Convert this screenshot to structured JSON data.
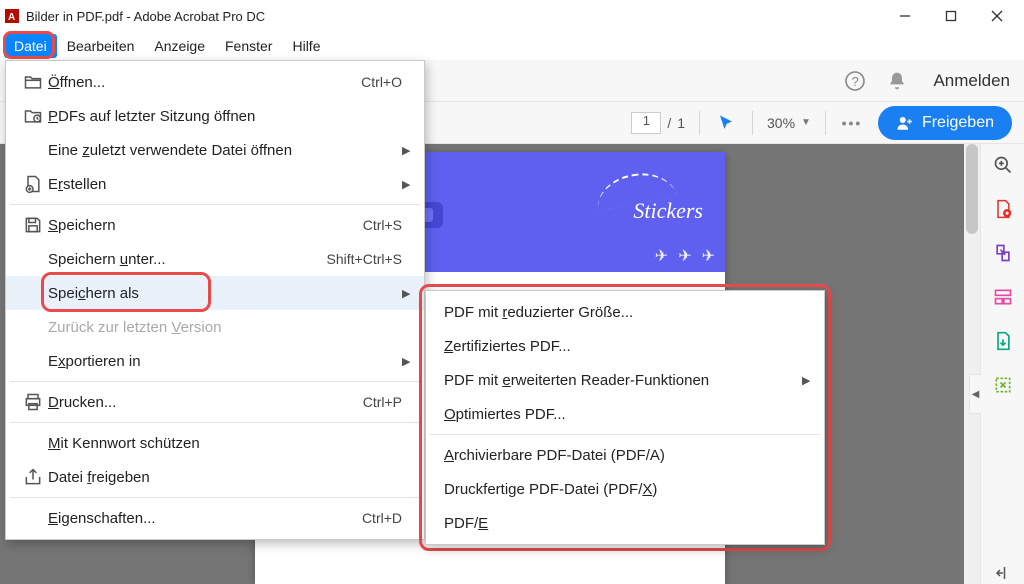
{
  "title": "Bilder in PDF.pdf - Adobe Acrobat Pro DC",
  "menubar": {
    "items": [
      "Datei",
      "Bearbeiten",
      "Anzeige",
      "Fenster",
      "Hilfe"
    ],
    "active": 0
  },
  "topbar": {
    "anmelden": "Anmelden"
  },
  "toolbar": {
    "page_current": "1",
    "page_total": "1",
    "zoom": "30%",
    "freigeben": "Freigeben"
  },
  "banner": {
    "stickers": "Stickers"
  },
  "dropdown": {
    "items": [
      {
        "icon": "folder-open",
        "label": "Öffnen...",
        "u": "Ö",
        "shortcut": "Ctrl+O"
      },
      {
        "icon": "folder-recent",
        "label": "PDFs auf letzter Sitzung öffnen",
        "u": "P"
      },
      {
        "label": "Eine zuletzt verwendete Datei öffnen",
        "u": "z",
        "submenu": true
      },
      {
        "icon": "create",
        "label": "Erstellen",
        "u": "r",
        "submenu": true
      },
      {
        "sep": true
      },
      {
        "icon": "save",
        "label": "Speichern",
        "u": "S",
        "shortcut": "Ctrl+S"
      },
      {
        "label": "Speichern unter...",
        "u": "u",
        "shortcut": "Shift+Ctrl+S"
      },
      {
        "label": "Speichern als",
        "u": "c",
        "submenu": true,
        "hover": true,
        "highlight": true
      },
      {
        "label": "Zurück zur letzten Version",
        "u": "V",
        "disabled": true
      },
      {
        "label": "Exportieren in",
        "u": "x",
        "submenu": true
      },
      {
        "sep": true
      },
      {
        "icon": "print",
        "label": "Drucken...",
        "u": "D",
        "shortcut": "Ctrl+P"
      },
      {
        "sep": true
      },
      {
        "label": "Mit Kennwort schützen",
        "u": "M"
      },
      {
        "icon": "share",
        "label": "Datei freigeben",
        "u": "f"
      },
      {
        "sep": true
      },
      {
        "label": "Eigenschaften...",
        "u": "E",
        "shortcut": "Ctrl+D"
      }
    ]
  },
  "submenu": {
    "items": [
      {
        "label": "PDF mit reduzierter Größe...",
        "u": "r"
      },
      {
        "label": "Zertifiziertes PDF...",
        "u": "Z"
      },
      {
        "label": "PDF mit erweiterten Reader-Funktionen",
        "u": "e",
        "submenu": true
      },
      {
        "label": "Optimiertes PDF...",
        "u": "O"
      },
      {
        "sep": true
      },
      {
        "label": "Archivierbare PDF-Datei (PDF/A)",
        "u": "A"
      },
      {
        "label": "Druckfertige PDF-Datei (PDF/X)",
        "u": "X"
      },
      {
        "label": "PDF/E",
        "u": "E"
      }
    ]
  }
}
